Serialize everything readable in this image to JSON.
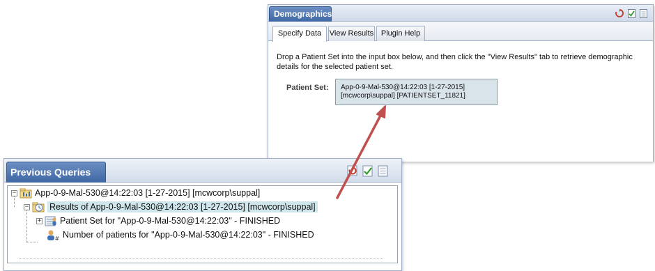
{
  "demographics": {
    "title": "Demographics",
    "tabs": [
      {
        "label": "Specify Data",
        "active": true
      },
      {
        "label": "View Results",
        "active": false
      },
      {
        "label": "Plugin Help",
        "active": false
      }
    ],
    "instructions": "Drop a Patient Set into the input box below, and then click the \"View Results\" tab to retrieve demographic details for the selected patient set.",
    "patient_set_label": "Patient Set:",
    "patient_set_value_line1": "App-0-9-Mal-530@14:22:03 [1-27-2015]",
    "patient_set_value_line2": "[mcwcorp\\suppal] [PATIENTSET_11821]"
  },
  "previous_queries": {
    "title": "Previous Queries",
    "tree": {
      "root_label": "App-0-9-Mal-530@14:22:03 [1-27-2015] [mcwcorp\\suppal]",
      "results_label": "Results of App-0-9-Mal-530@14:22:03 [1-27-2015] [mcwcorp\\suppal]",
      "patient_set_label": "Patient Set for \"App-0-9-Mal-530@14:22:03\" - FINISHED",
      "patient_count_label": "Number of patients for \"App-0-9-Mal-530@14:22:03\" - FINISHED"
    }
  },
  "colors": {
    "title_tab": "#4a70aa",
    "selected_row": "#cfe6ec",
    "patient_set_box": "#d9e3ea",
    "arrow": "#c0504d"
  },
  "icons": [
    "refresh-icon",
    "check-document-icon",
    "document-icon",
    "query-folder-icon",
    "results-clock-icon",
    "patient-set-icon",
    "patient-count-icon"
  ]
}
